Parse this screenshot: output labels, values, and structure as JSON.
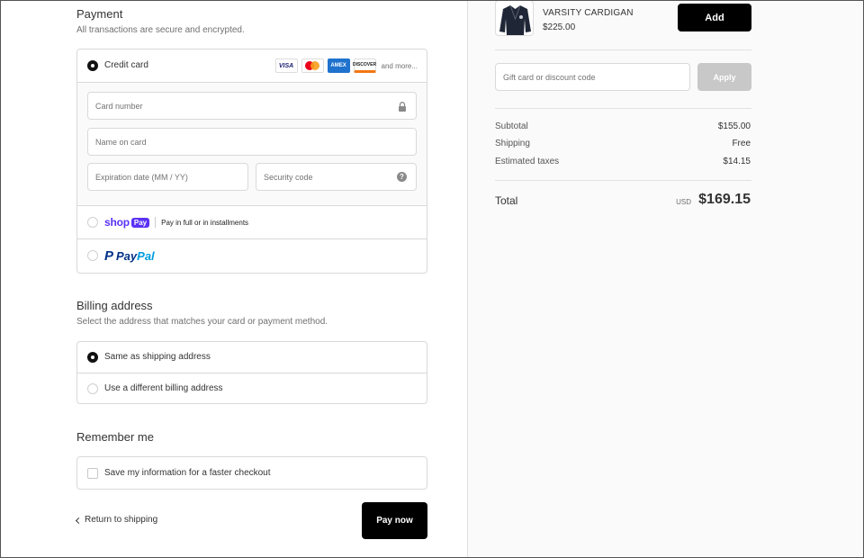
{
  "payment": {
    "title": "Payment",
    "subtitle": "All transactions are secure and encrypted.",
    "credit_card": {
      "label": "Credit card",
      "brands": [
        "VISA",
        "AMEX",
        "DISCOVER"
      ],
      "and_more": "and more...",
      "card_number_placeholder": "Card number",
      "name_placeholder": "Name on card",
      "expiry_placeholder": "Expiration date (MM / YY)",
      "security_placeholder": "Security code",
      "help_glyph": "?"
    },
    "shop_pay": {
      "word": "shop",
      "pill": "Pay",
      "text": "Pay in full or in installments"
    },
    "paypal": {
      "p": "P",
      "pay": "Pay",
      "pal": "Pal"
    }
  },
  "billing": {
    "title": "Billing address",
    "subtitle": "Select the address that matches your card or payment method.",
    "same_label": "Same as shipping address",
    "different_label": "Use a different billing address"
  },
  "remember": {
    "title": "Remember me",
    "save_label": "Save my information for a faster checkout"
  },
  "footer": {
    "return_label": "Return to shipping",
    "pay_now_label": "Pay now"
  },
  "summary": {
    "product": {
      "name": "VARSITY CARDIGAN",
      "price": "$225.00",
      "add_label": "Add"
    },
    "discount_placeholder": "Gift card or discount code",
    "apply_label": "Apply",
    "subtotal_label": "Subtotal",
    "subtotal_value": "$155.00",
    "shipping_label": "Shipping",
    "shipping_value": "Free",
    "taxes_label": "Estimated taxes",
    "taxes_value": "$14.15",
    "total_label": "Total",
    "total_currency": "USD",
    "total_value": "$169.15"
  },
  "colors": {
    "primary_button": "#000000",
    "shop_pay": "#5a31f4",
    "paypal_dark": "#003087",
    "paypal_light": "#009cde",
    "disabled_button": "#c8c8c8"
  }
}
